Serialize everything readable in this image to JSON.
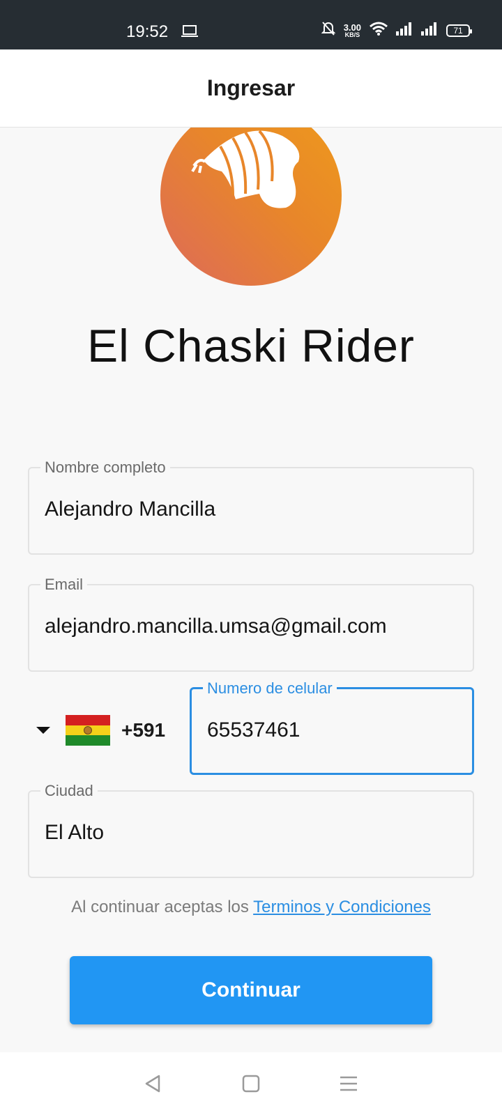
{
  "status_bar": {
    "time": "19:52",
    "net_speed_value": "3.00",
    "net_speed_unit": "KB/S",
    "battery": "71",
    "icons": [
      "laptop-icon",
      "bell-off-icon",
      "wifi-icon",
      "signal-icon",
      "signal-icon",
      "battery-icon"
    ]
  },
  "header": {
    "title": "Ingresar"
  },
  "app": {
    "name": "El Chaski Rider",
    "logo_colors": [
      "#ee9a1c",
      "#dd6a5a"
    ]
  },
  "form": {
    "full_name": {
      "label": "Nombre completo",
      "value": "Alejandro Mancilla"
    },
    "email": {
      "label": "Email",
      "value": "alejandro.mancilla.umsa@gmail.com"
    },
    "phone": {
      "country_code": "+591",
      "country_flag": "bolivia-flag-icon",
      "label": "Numero de celular",
      "value": "65537461"
    },
    "city": {
      "label": "Ciudad",
      "value": "El Alto"
    }
  },
  "terms": {
    "prefix": "Al continuar aceptas los ",
    "link": "Terminos y Condiciones"
  },
  "buttons": {
    "continue": "Continuar"
  },
  "colors": {
    "accent": "#2196f3",
    "focus": "#2b8ee2",
    "status_bar": "#262d33"
  },
  "nav_bar": {
    "icons": [
      "back-icon",
      "home-icon",
      "menu-icon"
    ]
  }
}
